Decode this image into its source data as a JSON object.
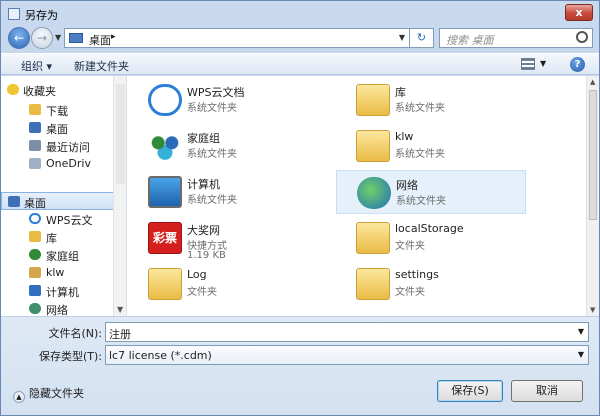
{
  "window": {
    "title": "另存为",
    "close_label": "x"
  },
  "nav": {
    "back_glyph": "←",
    "forward_glyph": "→",
    "breadcrumb": "桌面",
    "breadcrumb_sep": "▸",
    "refresh_glyph": "↻",
    "search_placeholder": "搜索 桌面"
  },
  "toolbar": {
    "organize": "组织 ▾",
    "new_folder": "新建文件夹",
    "help": "?"
  },
  "sidebar": {
    "items": [
      {
        "label": "收藏夹",
        "icon": "star-icon"
      },
      {
        "label": "下载",
        "icon": "download-folder-icon"
      },
      {
        "label": "桌面",
        "icon": "desktop-icon"
      },
      {
        "label": "最近访问",
        "icon": "recent-icon"
      },
      {
        "label": "OneDriv",
        "icon": "onedrive-icon"
      },
      {
        "label": "桌面",
        "icon": "desktop-icon",
        "selected": true
      },
      {
        "label": "WPS云文",
        "icon": "cloud-icon"
      },
      {
        "label": "库",
        "icon": "library-icon"
      },
      {
        "label": "家庭组",
        "icon": "homegroup-icon"
      },
      {
        "label": "klw",
        "icon": "user-icon"
      },
      {
        "label": "计算机",
        "icon": "computer-icon"
      },
      {
        "label": "网络",
        "icon": "network-icon"
      }
    ]
  },
  "files": [
    {
      "name": "WPS云文档",
      "type": "系统文件夹",
      "icon": "cloud-icon"
    },
    {
      "name": "库",
      "type": "系统文件夹",
      "icon": "library-icon"
    },
    {
      "name": "家庭组",
      "type": "系统文件夹",
      "icon": "homegroup-icon"
    },
    {
      "name": "klw",
      "type": "系统文件夹",
      "icon": "user-folder-icon"
    },
    {
      "name": "计算机",
      "type": "系统文件夹",
      "icon": "computer-icon"
    },
    {
      "name": "网络",
      "type": "系统文件夹",
      "icon": "network-icon"
    },
    {
      "name": "大奖网",
      "type": "快捷方式",
      "size": "1.19 KB",
      "icon": "lottery-icon",
      "icon_text": "彩票"
    },
    {
      "name": "localStorage",
      "type": "文件夹",
      "icon": "folder-icon"
    },
    {
      "name": "Log",
      "type": "文件夹",
      "icon": "folder-icon"
    },
    {
      "name": "settings",
      "type": "文件夹",
      "icon": "folder-icon"
    }
  ],
  "form": {
    "filename_label": "文件名(N):",
    "filename_value": "注册",
    "filetype_label": "保存类型(T):",
    "filetype_value": "lc7 license (*.cdm)"
  },
  "footer": {
    "hide_folders": "隐藏文件夹",
    "save": "保存(S)",
    "cancel": "取消"
  },
  "colors": {
    "accent": "#2f68b4",
    "window_frame": "#c9d9ee",
    "close_red": "#c8493a",
    "selection": "#cfe1f6"
  }
}
